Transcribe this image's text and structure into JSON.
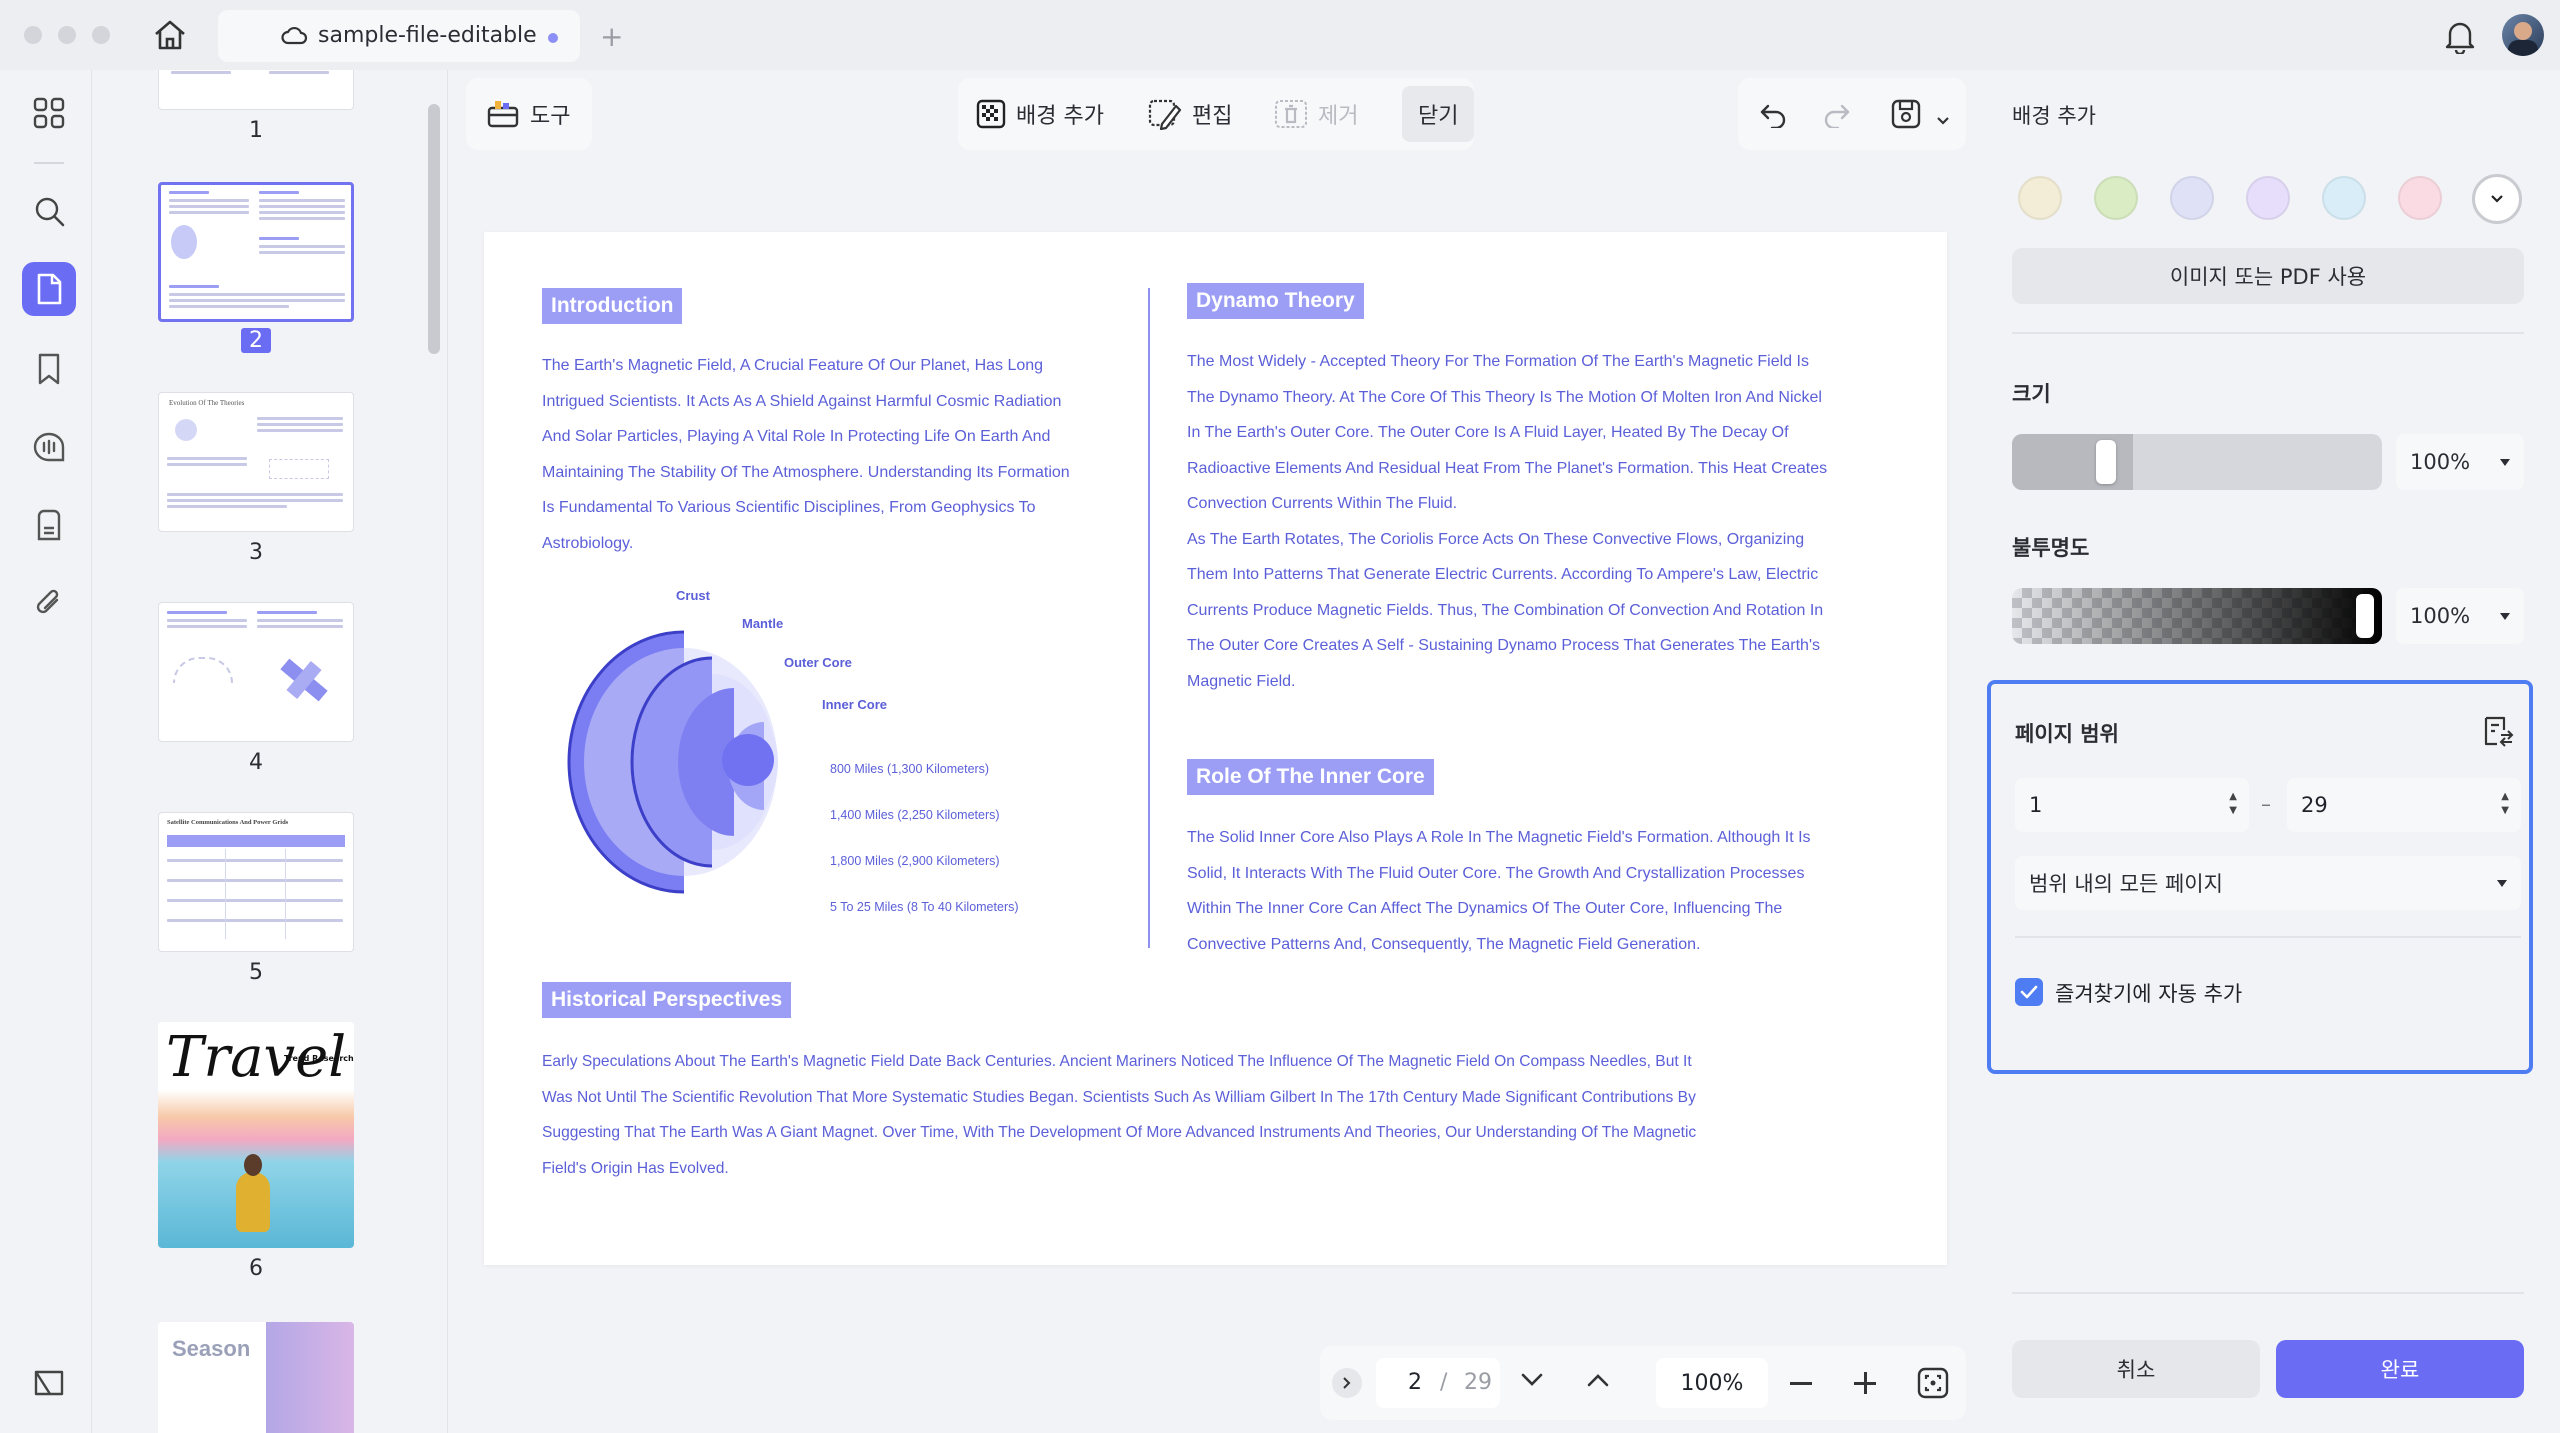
{
  "window": {
    "tab_title": "sample-file-editable"
  },
  "thumbnails": [
    {
      "label": "1"
    },
    {
      "label": "2"
    },
    {
      "label": "3"
    },
    {
      "label": "4"
    },
    {
      "label": "5"
    },
    {
      "label": "6"
    }
  ],
  "thumbnail_text": {
    "t3_title": "Evolution Of The Theories",
    "t5_title": "Satellite Communications And Power Grids",
    "t6_title": "Travel",
    "t6_sub": "Trend Research",
    "t7_title": "Season"
  },
  "toolbar": {
    "tools_label": "도구",
    "add_background": "배경 추가",
    "edit": "편집",
    "remove": "제거",
    "close": "닫기"
  },
  "document": {
    "intro_heading": "Introduction",
    "intro_lines": [
      "The Earth's Magnetic Field, A Crucial Feature Of Our Planet, Has Long",
      "Intrigued Scientists. It Acts As A Shield Against Harmful Cosmic Radiation",
      "And Solar Particles, Playing A Vital Role In Protecting Life On Earth And",
      "Maintaining The Stability Of The Atmosphere. Understanding Its Formation",
      "Is Fundamental To Various Scientific Disciplines, From Geophysics To",
      "Astrobiology."
    ],
    "diagram": {
      "crust": "Crust",
      "mantle": "Mantle",
      "outer_core": "Outer Core",
      "inner_core": "Inner Core",
      "d1": "800 Miles (1,300 Kilometers)",
      "d2": "1,400 Miles (2,250 Kilometers)",
      "d3": "1,800 Miles (2,900 Kilometers)",
      "d4": "5 To 25 Miles (8 To 40 Kilometers)"
    },
    "dynamo_heading": "Dynamo Theory",
    "dynamo_lines": [
      "The Most Widely - Accepted Theory For The Formation Of The Earth's Magnetic Field Is",
      "The Dynamo Theory. At The Core Of This Theory Is The Motion Of Molten Iron And Nickel",
      "In The Earth's Outer Core. The Outer Core Is A Fluid Layer, Heated By The Decay Of",
      "Radioactive Elements And Residual Heat From The Planet's Formation. This Heat Creates",
      "Convection Currents Within The Fluid.",
      "As The Earth Rotates, The Coriolis Force Acts On These Convective Flows, Organizing",
      "Them Into Patterns That Generate Electric Currents. According To Ampere's Law, Electric",
      "Currents Produce Magnetic Fields. Thus, The Combination Of Convection And Rotation In",
      "The Outer Core Creates A Self - Sustaining Dynamo Process That Generates The Earth's",
      "Magnetic Field."
    ],
    "inner_core_heading": "Role Of The Inner Core",
    "inner_core_lines": [
      "The Solid Inner Core Also Plays A Role In The Magnetic Field's Formation. Although It Is",
      "Solid, It Interacts With The Fluid Outer Core. The Growth And Crystallization Processes",
      "Within The Inner Core Can Affect The Dynamics Of The Outer Core, Influencing The",
      "Convective Patterns And, Consequently, The Magnetic Field Generation."
    ],
    "history_heading": "Historical Perspectives",
    "history_lines": [
      "Early Speculations About The Earth's Magnetic Field Date Back Centuries. Ancient Mariners Noticed The Influence Of The Magnetic Field On Compass Needles, But It",
      "Was Not Until The Scientific Revolution That More Systematic Studies Began. Scientists Such As William Gilbert In The 17th Century Made Significant Contributions By",
      "Suggesting That The Earth Was A Giant Magnet. Over Time, With The Development Of More Advanced Instruments And Theories, Our Understanding Of The Magnetic",
      "Field's Origin Has Evolved."
    ]
  },
  "pager": {
    "current": "2",
    "separator": "/",
    "total": "29",
    "zoom": "100%"
  },
  "panel": {
    "title": "배경 추가",
    "swatches": [
      "#f3ecd6",
      "#d9ecc4",
      "#dfe2f7",
      "#e6defa",
      "#d8edf7",
      "#fadbe3"
    ],
    "use_image_pdf": "이미지 또는 PDF 사용",
    "size_label": "크기",
    "size_value": "100%",
    "size_level": 0.1,
    "opacity_label": "불투명도",
    "opacity_value": "100%",
    "opacity_level": 1.0,
    "page_range_label": "페이지 범위",
    "range_from": "1",
    "range_dash": "–",
    "range_to": "29",
    "range_option": "범위 내의 모든 페이지",
    "auto_favorite_label": "즐겨찾기에 자동 추가",
    "auto_favorite_checked": true,
    "cancel": "취소",
    "done": "완료"
  }
}
